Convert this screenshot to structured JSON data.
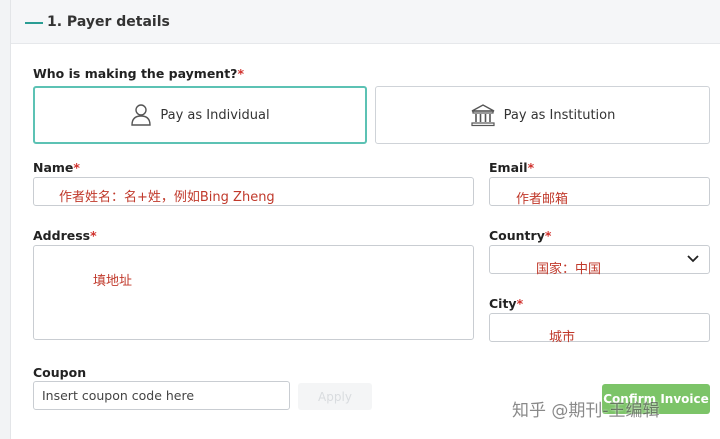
{
  "section": {
    "title": "1. Payer details"
  },
  "payer_type": {
    "label": "Who is making the payment?",
    "options": [
      {
        "label": "Pay as Individual",
        "icon": "person-icon",
        "selected": true
      },
      {
        "label": "Pay as Institution",
        "icon": "institution-icon",
        "selected": false
      }
    ]
  },
  "fields": {
    "name": {
      "label": "Name",
      "annotation": "作者姓名：名+姓，例如Bing Zheng"
    },
    "email": {
      "label": "Email",
      "annotation": "作者邮箱"
    },
    "address": {
      "label": "Address",
      "annotation": "填地址"
    },
    "country": {
      "label": "Country",
      "annotation": "国家：中国"
    },
    "city": {
      "label": "City",
      "annotation": "城市"
    }
  },
  "required_marker": "*",
  "coupon": {
    "label": "Coupon",
    "placeholder": "Insert coupon code here",
    "apply_label": "Apply"
  },
  "confirm_label": "Confirm Invoice",
  "watermark": "知乎 @期刊-王编辑",
  "colors": {
    "accent": "#5cc2b4",
    "required": "#d0312d",
    "annotation": "#c0392b",
    "confirm": "#7cc468"
  }
}
